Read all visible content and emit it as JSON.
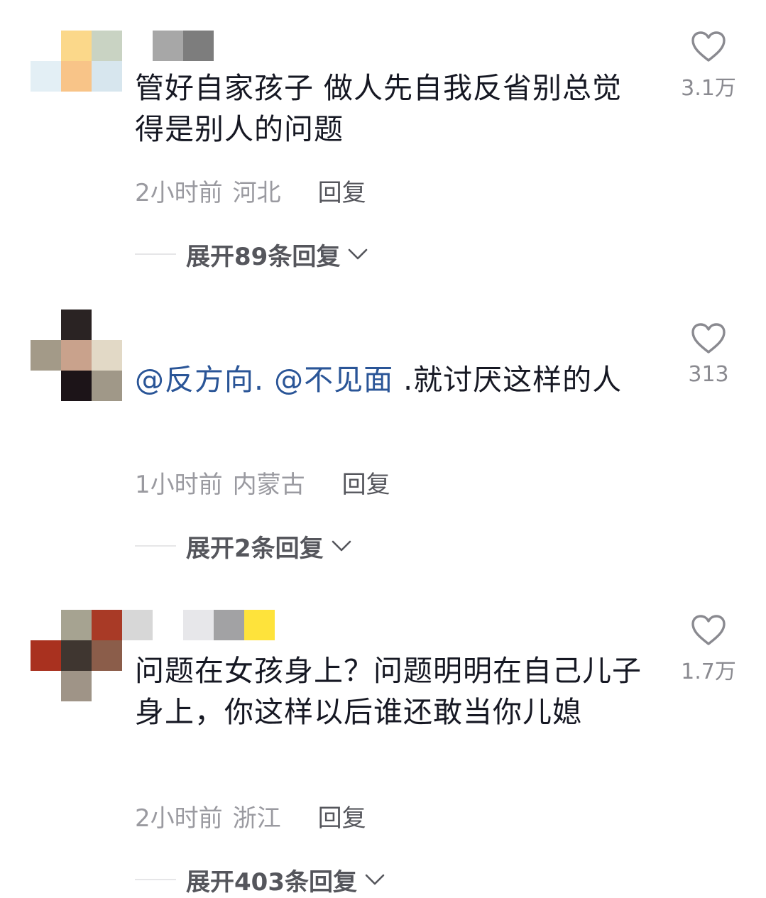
{
  "comments": [
    {
      "text": "管好自家孩子 做人先自我反省别总觉得是别人的问题",
      "time": "2小时前",
      "location": "河北",
      "reply_label": "回复",
      "expand_label": "展开89条回复",
      "likes": "3.1万",
      "avatar_colors": [
        "#ffffff",
        "#fbd88a",
        "#c9d3c3",
        "#e3eff5",
        "#f8c488",
        "#d7e6ee"
      ],
      "name_colors": [
        "#a7a7a7",
        "#7d7d7d",
        "#ffffff"
      ]
    },
    {
      "mention_1": "@反方向.",
      "mention_2": "@不见面",
      "text_rest": ".就讨厌这样的人",
      "time": "1小时前",
      "location": "内蒙古",
      "reply_label": "回复",
      "expand_label": "展开2条回复",
      "likes": "313",
      "avatar_colors": [
        "#ffffff",
        "#2a2323",
        "#ffffff",
        "#a39a88",
        "#c9a28c",
        "#e2d9c6",
        "#ffffff",
        "#1c1418",
        "#a09888"
      ],
      "name_colors": [
        "#ffffff"
      ]
    },
    {
      "text": "问题在女孩身上？问题明明在自己儿子身上，你这样以后谁还敢当你儿媳",
      "time": "2小时前",
      "location": "浙江",
      "reply_label": "回复",
      "expand_label": "展开403条回复",
      "likes": "1.7万",
      "avatar_colors": [
        "#ffffff",
        "#a6a391",
        "#a93a26",
        "#a9311f",
        "#3f3630",
        "#8b5d4a",
        "#ffffff",
        "#9f9487",
        "#ffffff"
      ],
      "name_colors": [
        "#d7d7d7",
        "#ffffff",
        "#e7e7ea",
        "#a2a2a4",
        "#fee33b"
      ]
    }
  ],
  "icons": {
    "like": "heart-outline-icon",
    "expand": "chevron-down-icon"
  },
  "colors": {
    "text": "#161823",
    "mention": "#2a5597",
    "meta": "#9a9aa0",
    "reply": "#55565c"
  }
}
